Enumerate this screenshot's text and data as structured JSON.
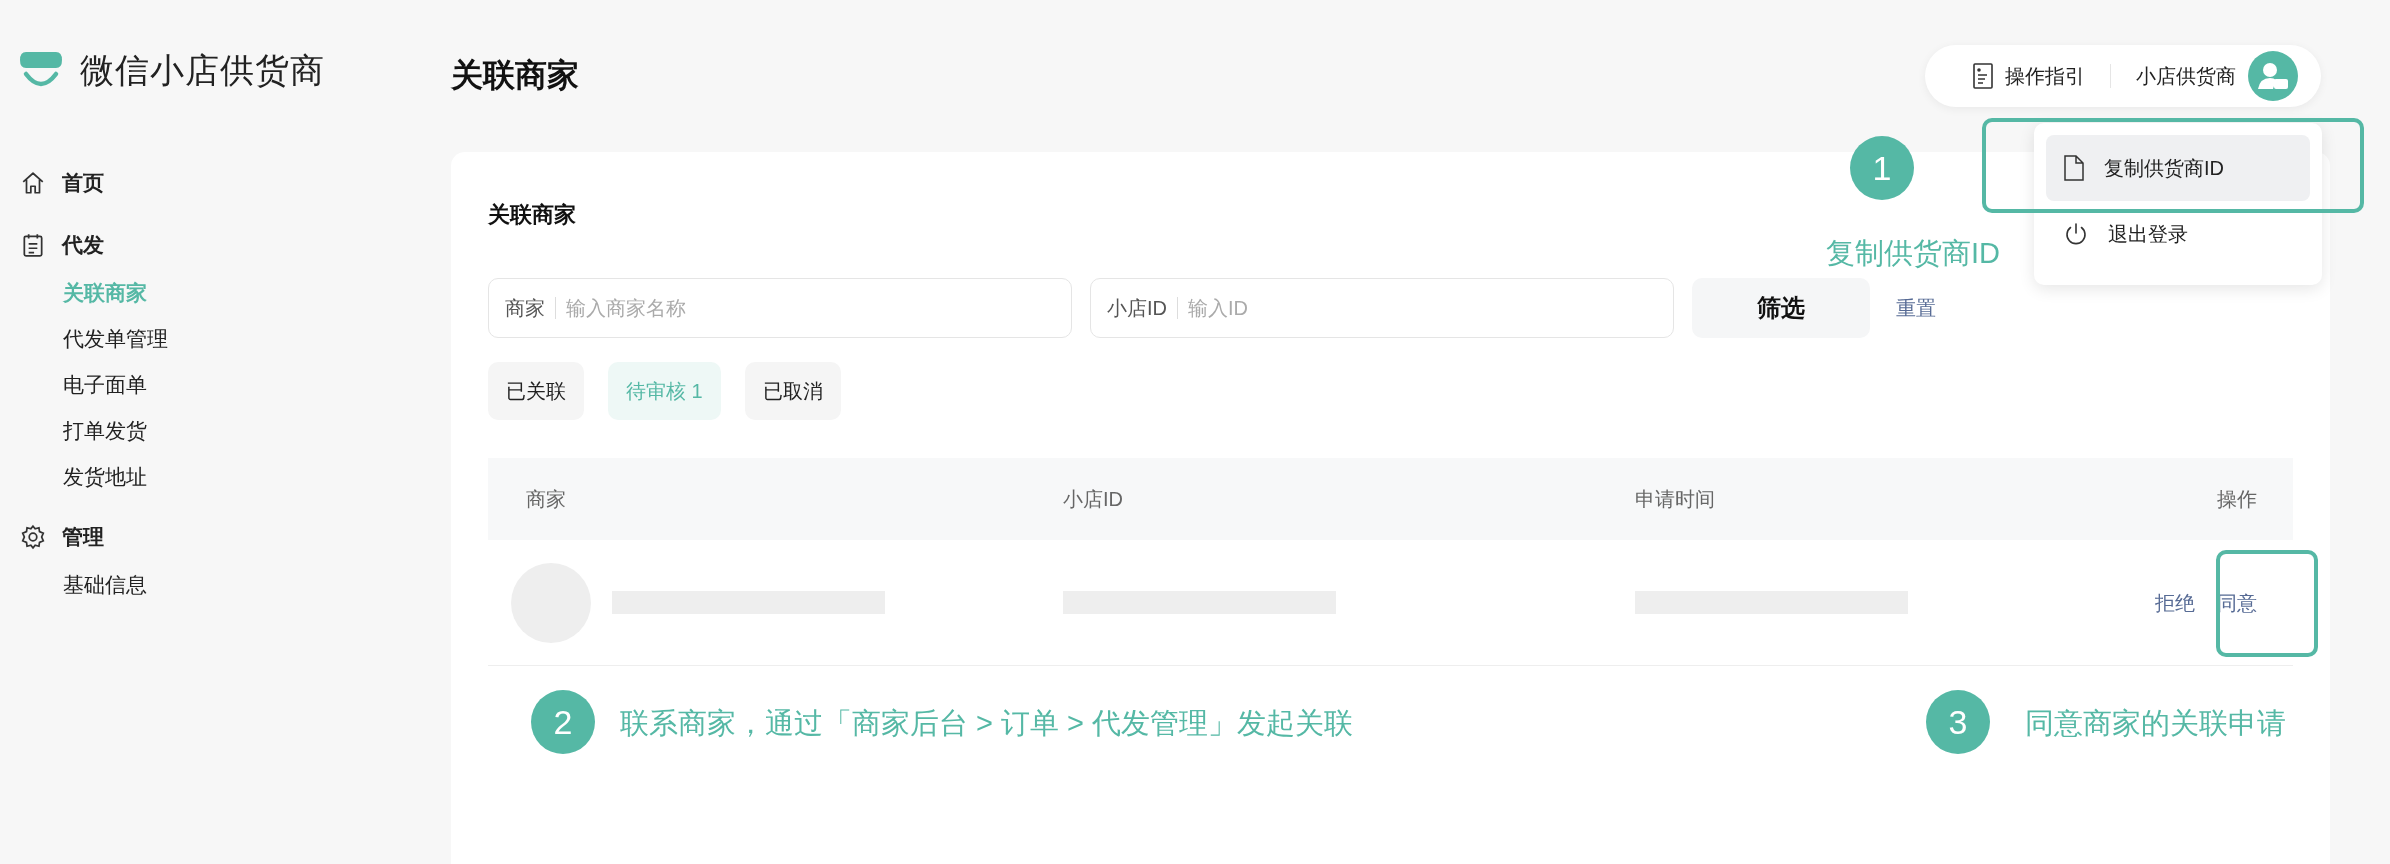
{
  "sidebar": {
    "brand": "微信小店供货商",
    "groups": [
      {
        "label": "首页"
      },
      {
        "label": "代发",
        "items": [
          {
            "label": "关联商家",
            "selected": true
          },
          {
            "label": "代发单管理",
            "selected": false
          },
          {
            "label": "电子面单",
            "selected": false
          },
          {
            "label": "打单发货",
            "selected": false
          },
          {
            "label": "发货地址",
            "selected": false
          }
        ]
      },
      {
        "label": "管理",
        "items": [
          {
            "label": "基础信息",
            "selected": false
          }
        ]
      }
    ]
  },
  "header": {
    "title": "关联商家",
    "guide": "操作指引",
    "user": "小店供货商"
  },
  "user_menu": {
    "items": [
      {
        "label": "复制供货商ID",
        "selected": true
      },
      {
        "label": "退出登录",
        "selected": false
      }
    ]
  },
  "card": {
    "title": "关联商家",
    "filters": [
      {
        "label": "商家",
        "placeholder": "输入商家名称"
      },
      {
        "label": "小店ID",
        "placeholder": "输入ID"
      }
    ],
    "filter_button": "筛选",
    "reset_link": "重置",
    "status_tabs": [
      {
        "label": "已关联",
        "selected": false
      },
      {
        "label": "待审核 1",
        "selected": true
      },
      {
        "label": "已取消",
        "selected": false
      }
    ],
    "table": {
      "columns": [
        "商家",
        "小店ID",
        "申请时间",
        "操作"
      ],
      "rows": [
        {
          "kind": "loading",
          "actions": [
            "拒绝",
            "同意"
          ]
        }
      ]
    }
  },
  "annotations": [
    {
      "number": "1",
      "text": "复制供货商ID"
    },
    {
      "number": "2",
      "text": "联系商家，通过「商家后台 > 订单 > 代发管理」发起关联"
    },
    {
      "number": "3",
      "text": "同意商家的关联申请"
    }
  ]
}
